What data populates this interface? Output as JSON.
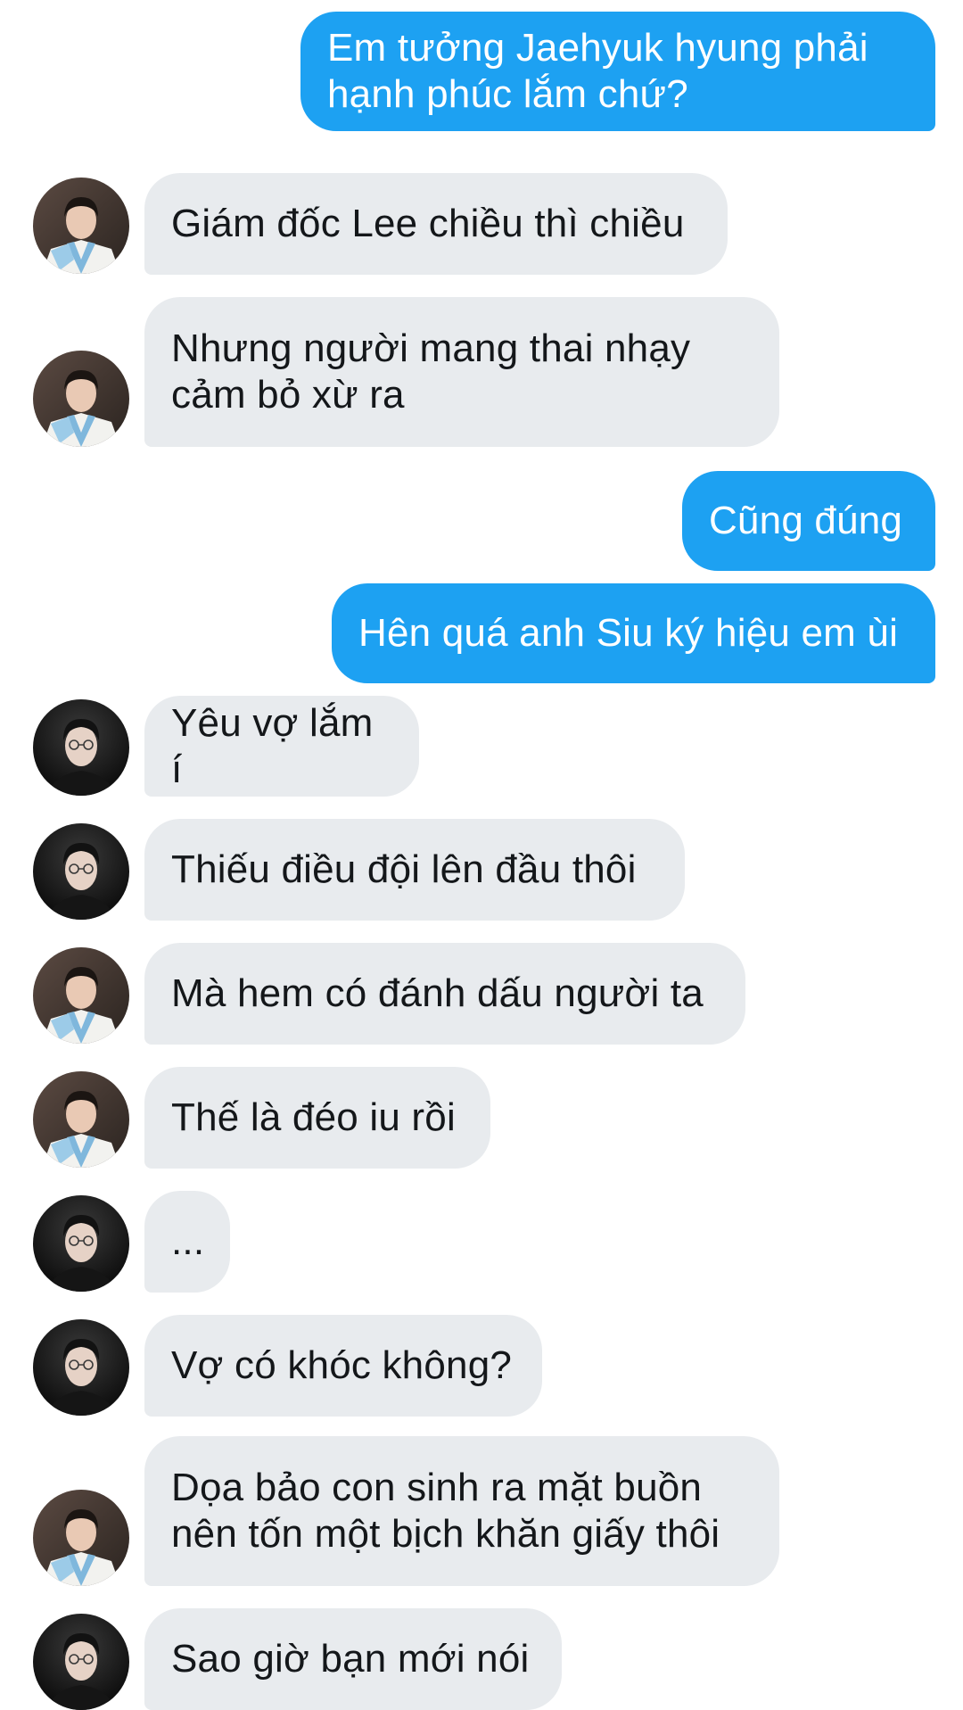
{
  "theme": {
    "outgoing_bubble_color": "#1da1f2",
    "incoming_bubble_color": "#e8ebee",
    "outgoing_text_color": "#ffffff",
    "incoming_text_color": "#14171a"
  },
  "messages": [
    {
      "direction": "outgoing",
      "text": "Em tưởng Jaehyuk hyung phải\nhạnh phúc lắm chứ?"
    },
    {
      "direction": "incoming",
      "avatar": "avatar-hanbok",
      "text": "Giám đốc Lee chiều thì chiều"
    },
    {
      "direction": "incoming",
      "avatar": "avatar-hanbok",
      "text": "Nhưng người mang thai nhạy\ncảm bỏ xừ ra"
    },
    {
      "direction": "outgoing",
      "text": "Cũng đúng"
    },
    {
      "direction": "outgoing",
      "text": "Hên quá anh Siu ký hiệu em ùi"
    },
    {
      "direction": "incoming",
      "avatar": "avatar-glasses",
      "text": "Yêu vợ lắm í"
    },
    {
      "direction": "incoming",
      "avatar": "avatar-glasses",
      "text": "Thiếu điều đội lên đầu thôi"
    },
    {
      "direction": "incoming",
      "avatar": "avatar-hanbok",
      "text": "Mà hem có đánh dấu người ta"
    },
    {
      "direction": "incoming",
      "avatar": "avatar-hanbok",
      "text": "Thế là đéo iu rồi"
    },
    {
      "direction": "incoming",
      "avatar": "avatar-glasses",
      "text": "..."
    },
    {
      "direction": "incoming",
      "avatar": "avatar-glasses",
      "text": "Vợ có khóc không?"
    },
    {
      "direction": "incoming",
      "avatar": "avatar-hanbok",
      "text": "Dọa bảo con sinh ra mặt buồn\nnên tốn một bịch khăn giấy thôi"
    },
    {
      "direction": "incoming",
      "avatar": "avatar-glasses",
      "text": "Sao giờ bạn mới nói"
    }
  ]
}
